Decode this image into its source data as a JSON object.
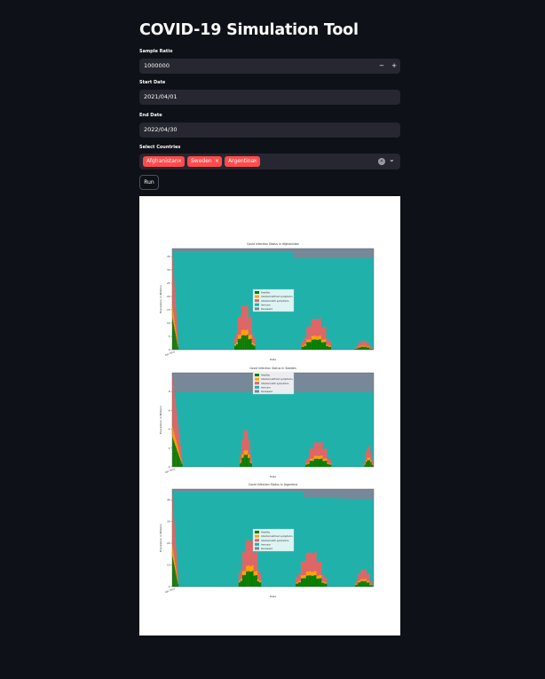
{
  "app": {
    "title": "COVID-19 Simulation Tool"
  },
  "sample_ratio": {
    "label": "Sample Ratio",
    "value": "1000000",
    "minus": "−",
    "plus": "+"
  },
  "start_date": {
    "label": "Start Date",
    "value": "2021/04/01"
  },
  "end_date": {
    "label": "End Date",
    "value": "2022/04/30"
  },
  "countries": {
    "label": "Select Countries",
    "selected": [
      "Afghanistan",
      "Sweden",
      "Argentina"
    ],
    "remove_symbol": "×",
    "clear_symbol": "✕",
    "dropdown_symbol": "⌄"
  },
  "run_button": {
    "label": "Run"
  },
  "colors": {
    "healthy": "#008000",
    "infected_without_symptoms": "#ffa500",
    "infected_with_symptoms": "#e06666",
    "immune": "#20b2aa",
    "deceased": "#778899"
  },
  "chart_data": [
    {
      "type": "area",
      "title": "Covid Infection Status in Afghanistan",
      "xlabel": "Date",
      "ylabel": "Population in Millions",
      "x_tick_labels": [
        "Apr 2021"
      ],
      "y_ticks": [
        0,
        5,
        10,
        15,
        20,
        25,
        30,
        35
      ],
      "ylim": [
        0,
        38
      ],
      "legend": [
        "Healthy",
        "Infected without symptoms",
        "Infected with symptoms",
        "Immune",
        "Deceased"
      ],
      "legend_position": "center"
    },
    {
      "type": "area",
      "title": "Covid Infection Status in Sweden",
      "xlabel": "Date",
      "ylabel": "Population in Millions",
      "x_tick_labels": [
        "Apr 2021"
      ],
      "y_ticks": [
        0,
        2,
        4,
        6,
        8
      ],
      "ylim": [
        0,
        10
      ],
      "legend": [
        "Healthy",
        "Infected without symptoms",
        "Infected with symptoms",
        "Immune",
        "Deceased"
      ],
      "legend_position": "top-center"
    },
    {
      "type": "area",
      "title": "Covid Infection Status in Argentina",
      "xlabel": "Date",
      "ylabel": "Population in Millions",
      "x_tick_labels": [
        "Apr 2021"
      ],
      "y_ticks": [
        0,
        10,
        20,
        30,
        40
      ],
      "ylim": [
        0,
        45
      ],
      "legend": [
        "Healthy",
        "Infected without symptoms",
        "Infected with symptoms",
        "Immune",
        "Deceased"
      ],
      "legend_position": "center"
    }
  ]
}
